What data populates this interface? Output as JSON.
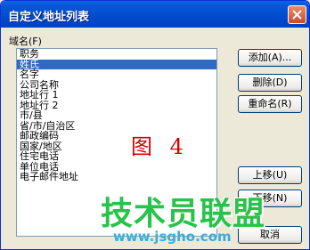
{
  "window": {
    "title": "自定义地址列表"
  },
  "field": {
    "label": "域名(F)"
  },
  "list": {
    "items": [
      {
        "label": "职务"
      },
      {
        "label": "姓氏"
      },
      {
        "label": "名字"
      },
      {
        "label": "公司名称"
      },
      {
        "label": "地址行 1"
      },
      {
        "label": "地址行 2"
      },
      {
        "label": "市/县"
      },
      {
        "label": "省/市/自治区"
      },
      {
        "label": "邮政编码"
      },
      {
        "label": "国家/地区"
      },
      {
        "label": "住宅电话"
      },
      {
        "label": "单位电话"
      },
      {
        "label": "电子邮件地址"
      }
    ],
    "selected_index": 1
  },
  "buttons": {
    "add": "添加(A)...",
    "delete": "删除(D)",
    "rename": "重命名(R)",
    "move_up": "上移(U)",
    "move_down": "下移(N)",
    "cancel": "取消"
  },
  "annotation": {
    "caption": "图 4"
  },
  "watermark": {
    "text": "技术员联盟",
    "url": "www.jsgho.com"
  },
  "colors": {
    "titlebar": "#0054e3",
    "selection": "#316ac5",
    "caption": "#d50000",
    "watermark_green": "#28c34a",
    "watermark_blue": "#3aaed8"
  }
}
